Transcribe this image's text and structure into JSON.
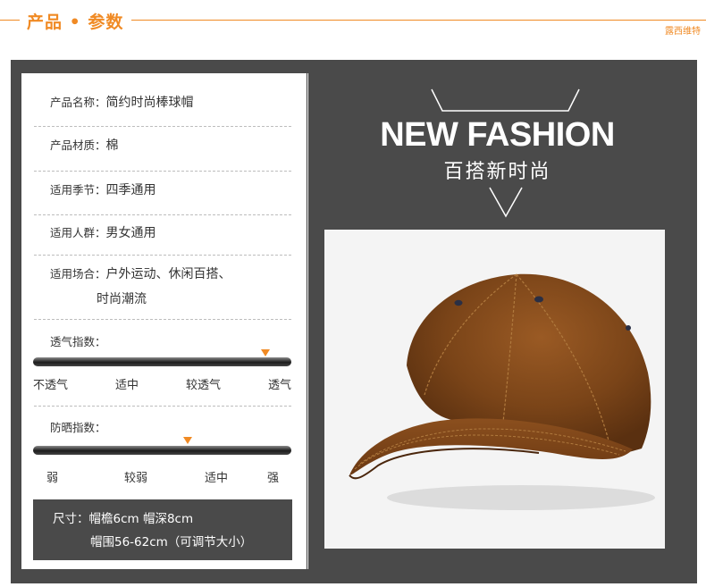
{
  "header": {
    "title": "产品 • 参数",
    "brand": "露西维特"
  },
  "specs": {
    "name_label": "产品名称：",
    "name_value": "简约时尚棒球帽",
    "material_label": "产品材质：",
    "material_value": "棉",
    "season_label": "适用季节：",
    "season_value": "四季通用",
    "people_label": "适用人群：",
    "people_value": "男女通用",
    "occasion_label": "适用场合：",
    "occasion_value_line1": "户外运动、休闲百搭、",
    "occasion_value_line2": "时尚潮流"
  },
  "breathability": {
    "label": "透气指数：",
    "ticks": [
      "不透气",
      "适中",
      "较透气",
      "透气"
    ],
    "level": 0.9
  },
  "sun_protection": {
    "label": "防晒指数：",
    "ticks": [
      "弱",
      "较弱",
      "适中",
      "强"
    ],
    "level": 0.6
  },
  "size": {
    "line1": "尺寸：帽檐6cm   帽深8cm",
    "line2": "帽围56-62cm（可调节大小）"
  },
  "visual": {
    "headline": "NEW FASHION",
    "subline": "百搭新时尚"
  },
  "colors": {
    "accent": "#f08a24",
    "panel": "#4a4a4a",
    "cap": "#7a4418"
  }
}
